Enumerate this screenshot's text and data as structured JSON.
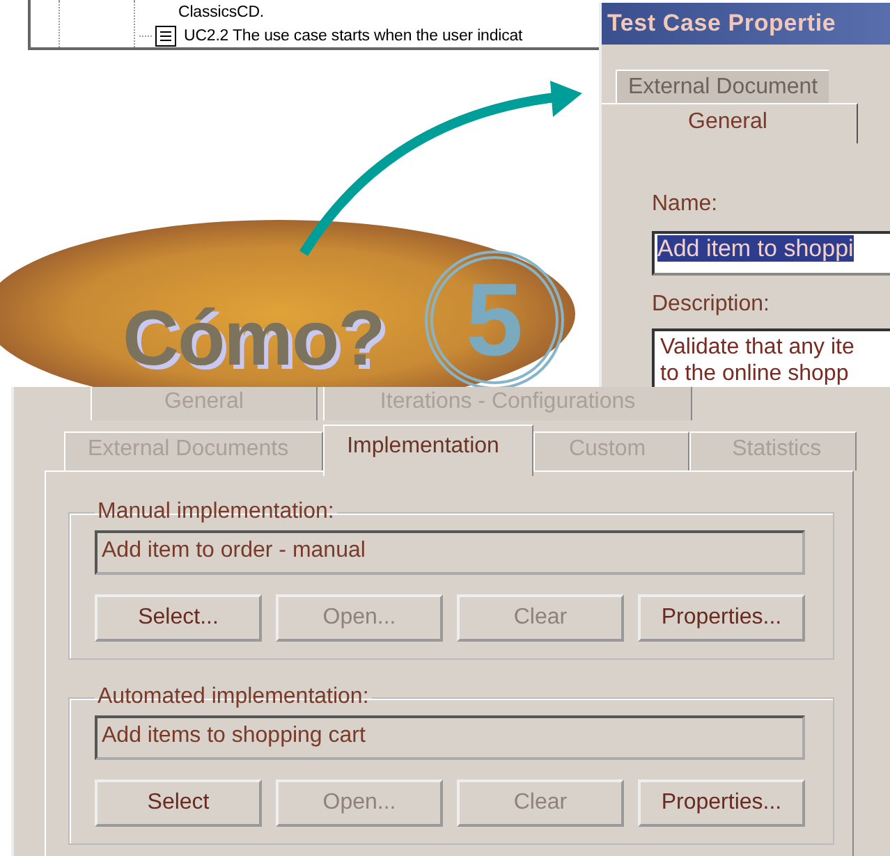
{
  "tree_window": {
    "items": [
      {
        "label": "ClassicsCD."
      },
      {
        "label": "UC2.2 The use case starts when the user indicat"
      }
    ]
  },
  "test_case_dialog": {
    "title": "Test Case Propertie",
    "tabs": [
      {
        "label": "External Document",
        "selected": false
      },
      {
        "label": "General",
        "selected": true
      }
    ],
    "name_label": "Name:",
    "name_value": "Add item to shoppi",
    "description_label": "Description:",
    "description_lines": [
      "Validate that any ite",
      "to the online shopp"
    ]
  },
  "callout": {
    "text": "Cómo?",
    "number": "5"
  },
  "implementation_dialog": {
    "tab_rows": [
      [
        {
          "label": "General",
          "selected": false
        },
        {
          "label": "Iterations - Configurations",
          "selected": false
        }
      ],
      [
        {
          "label": "External Documents",
          "selected": false
        },
        {
          "label": "Implementation",
          "selected": true
        },
        {
          "label": "Custom",
          "selected": false
        },
        {
          "label": "Statistics",
          "selected": false
        }
      ]
    ],
    "groups": [
      {
        "label": "Manual implementation:",
        "value": "Add item to order - manual",
        "buttons": [
          {
            "label": "Select...",
            "disabled": false
          },
          {
            "label": "Open...",
            "disabled": true
          },
          {
            "label": "Clear",
            "disabled": true
          },
          {
            "label": "Properties...",
            "disabled": false
          }
        ]
      },
      {
        "label": "Automated implementation:",
        "value": "Add items to shopping cart",
        "buttons": [
          {
            "label": "Select",
            "disabled": false
          },
          {
            "label": "Open...",
            "disabled": true
          },
          {
            "label": "Clear",
            "disabled": true
          },
          {
            "label": "Properties...",
            "disabled": false
          }
        ]
      }
    ]
  }
}
